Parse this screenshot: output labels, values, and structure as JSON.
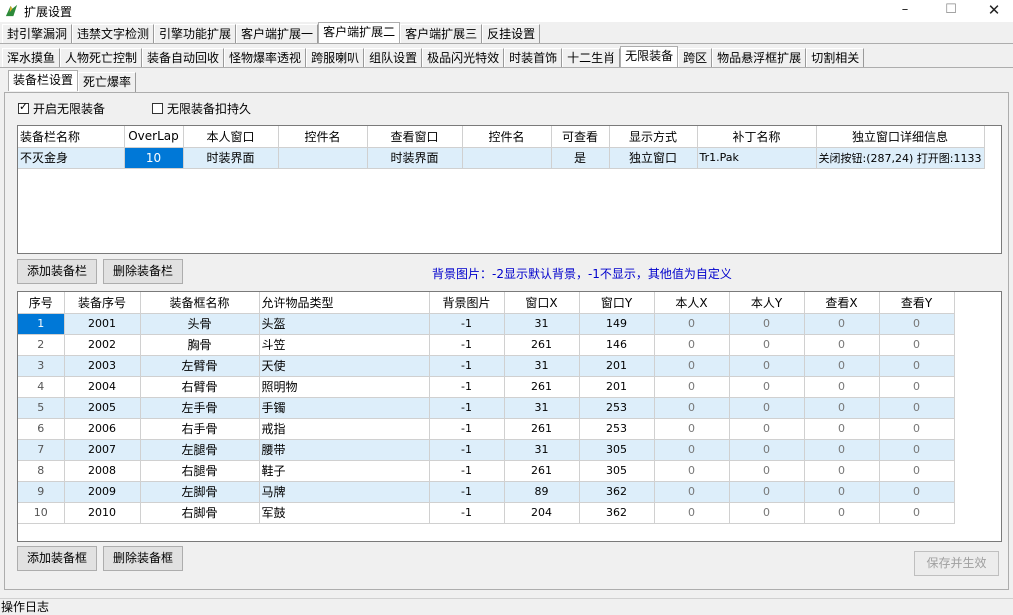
{
  "window": {
    "title": "扩展设置",
    "minimize": "–",
    "maximize": "☐",
    "close": "✕"
  },
  "tabs_row1": [
    "封引擎漏洞",
    "违禁文字检测",
    "引擎功能扩展",
    "客户端扩展一",
    "客户端扩展二",
    "客户端扩展三",
    "反挂设置"
  ],
  "tabs_row1_active": "客户端扩展二",
  "tabs_row2": [
    "浑水摸鱼",
    "人物死亡控制",
    "装备自动回收",
    "怪物爆率透视",
    "跨服喇叭",
    "组队设置",
    "极品闪光特效",
    "时装首饰",
    "十二生肖",
    "无限装备",
    "跨区",
    "物品悬浮框扩展",
    "切割相关"
  ],
  "tabs_row2_active": "无限装备",
  "tabs_row3": [
    "装备栏设置",
    "死亡爆率"
  ],
  "tabs_row3_active": "装备栏设置",
  "options": {
    "enable_label": "开启无限装备",
    "enable_checked": true,
    "durability_label": "无限装备扣持久",
    "durability_checked": false
  },
  "bar_table": {
    "headers": [
      "装备栏名称",
      "OverLap",
      "本人窗口",
      "控件名",
      "查看窗口",
      "控件名",
      "可查看",
      "显示方式",
      "补丁名称",
      "独立窗口详细信息"
    ],
    "rows": [
      [
        "不灭金身",
        "10",
        "时装界面",
        "",
        "时装界面",
        "",
        "是",
        "独立窗口",
        "Tr1.Pak",
        "关闭按钮:(287,24) 打开图:1133"
      ]
    ]
  },
  "buttons": {
    "add_bar": "添加装备栏",
    "del_bar": "删除装备栏",
    "add_frame": "添加装备框",
    "del_frame": "删除装备框",
    "save": "保存并生效"
  },
  "note": "背景图片：-2显示默认背景，-1不显示，其他值为自定义",
  "frame_table": {
    "headers": [
      "序号",
      "装备序号",
      "装备框名称",
      "允许物品类型",
      "背景图片",
      "窗口X",
      "窗口Y",
      "本人X",
      "本人Y",
      "查看X",
      "查看Y"
    ],
    "rows": [
      [
        "1",
        "2001",
        "头骨",
        "头盔",
        "-1",
        "31",
        "149",
        "0",
        "0",
        "0",
        "0"
      ],
      [
        "2",
        "2002",
        "胸骨",
        "斗笠",
        "-1",
        "261",
        "146",
        "0",
        "0",
        "0",
        "0"
      ],
      [
        "3",
        "2003",
        "左臂骨",
        "天使",
        "-1",
        "31",
        "201",
        "0",
        "0",
        "0",
        "0"
      ],
      [
        "4",
        "2004",
        "右臂骨",
        "照明物",
        "-1",
        "261",
        "201",
        "0",
        "0",
        "0",
        "0"
      ],
      [
        "5",
        "2005",
        "左手骨",
        "手镯",
        "-1",
        "31",
        "253",
        "0",
        "0",
        "0",
        "0"
      ],
      [
        "6",
        "2006",
        "右手骨",
        "戒指",
        "-1",
        "261",
        "253",
        "0",
        "0",
        "0",
        "0"
      ],
      [
        "7",
        "2007",
        "左腿骨",
        "腰带",
        "-1",
        "31",
        "305",
        "0",
        "0",
        "0",
        "0"
      ],
      [
        "8",
        "2008",
        "右腿骨",
        "鞋子",
        "-1",
        "261",
        "305",
        "0",
        "0",
        "0",
        "0"
      ],
      [
        "9",
        "2009",
        "左脚骨",
        "马牌",
        "-1",
        "89",
        "362",
        "0",
        "0",
        "0",
        "0"
      ],
      [
        "10",
        "2010",
        "右脚骨",
        "军鼓",
        "-1",
        "204",
        "362",
        "0",
        "0",
        "0",
        "0"
      ]
    ]
  },
  "status": {
    "label": "操作日志"
  }
}
